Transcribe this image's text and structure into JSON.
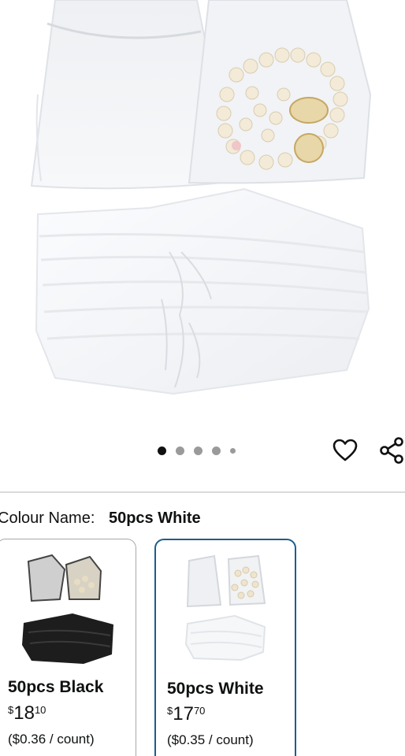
{
  "product": {
    "image_alt": "White organza drawstring gift bags"
  },
  "carousel": {
    "total": 5,
    "active_index": 0
  },
  "actions": {
    "wishlist_icon": "heart-icon",
    "share_icon": "share-icon"
  },
  "colour": {
    "label": "Colour Name:",
    "selected": "50pcs White"
  },
  "variants": [
    {
      "name": "50pcs Black",
      "currency": "$",
      "price_whole": "18",
      "price_fraction": "10",
      "unit_price": "($0.36 / count)",
      "selected": false
    },
    {
      "name": "50pcs White",
      "currency": "$",
      "price_whole": "17",
      "price_fraction": "70",
      "unit_price": "($0.35 / count)",
      "selected": true
    }
  ],
  "colors": {
    "selected_border": "#1d5d8f",
    "dot_active": "#111111",
    "dot_inactive": "#9a9a9a"
  }
}
